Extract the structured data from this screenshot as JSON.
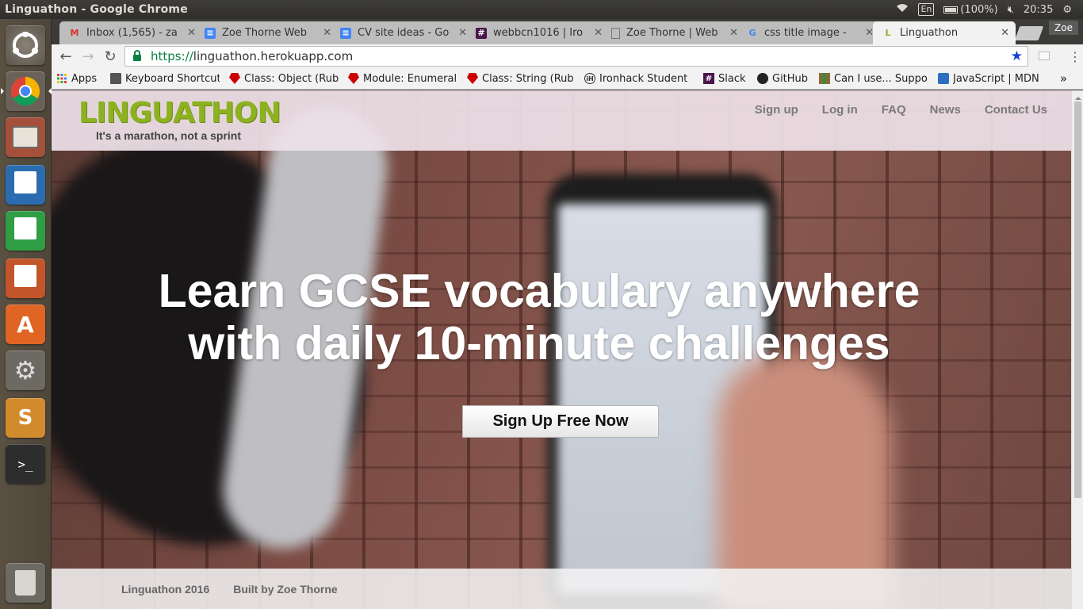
{
  "window": {
    "title": "Linguathon - Google Chrome"
  },
  "tray": {
    "keyboard": "En",
    "battery": "(100%)",
    "clock": "20:35"
  },
  "tabs": [
    {
      "label": "Inbox (1,565) - za",
      "favicon": "gmail-icon",
      "color": "#d93025"
    },
    {
      "label": "Zoe Thorne Web",
      "favicon": "docs-icon",
      "color": "#4285f4"
    },
    {
      "label": "CV site ideas - Go",
      "favicon": "docs-icon",
      "color": "#4285f4"
    },
    {
      "label": "webbcn1016 | Iro",
      "favicon": "slack-icon",
      "color": "#4a154b"
    },
    {
      "label": "Zoe Thorne | Web",
      "favicon": "page-icon",
      "color": "#777777"
    },
    {
      "label": "css title image -",
      "favicon": "google-icon",
      "color": "#4285f4"
    },
    {
      "label": "Linguathon",
      "favicon": "linguathon-icon",
      "color": "#8db21f"
    }
  ],
  "profile": "Zoe",
  "omnibox": {
    "scheme": "https://",
    "host": "linguathon.herokuapp.com"
  },
  "bookmarks": [
    {
      "label": "Apps",
      "icon": "apps-grid-icon",
      "color": "#e94235"
    },
    {
      "label": "Keyboard Shortcut",
      "icon": "keyboard-icon",
      "color": "#555555"
    },
    {
      "label": "Class: Object (Rub",
      "icon": "ruby-icon",
      "color": "#cc0000"
    },
    {
      "label": "Module: Enumeral",
      "icon": "ruby-icon",
      "color": "#cc0000"
    },
    {
      "label": "Class: String (Rub",
      "icon": "ruby-icon",
      "color": "#cc0000"
    },
    {
      "label": "Ironhack Student",
      "icon": "ironhack-icon",
      "color": "#333333"
    },
    {
      "label": "Slack",
      "icon": "slack-icon",
      "color": "#4a154b"
    },
    {
      "label": "GitHub",
      "icon": "github-icon",
      "color": "#222222"
    },
    {
      "label": "Can I use... Suppo",
      "icon": "caniuse-icon",
      "color": "#8a6a3a"
    },
    {
      "label": "JavaScript | MDN",
      "icon": "mdn-icon",
      "color": "#2c6fbf"
    }
  ],
  "bookmarks_more": "»",
  "site": {
    "logo": "LINGUATHON",
    "tagline": "It's a marathon, not a sprint",
    "nav": [
      "Sign up",
      "Log in",
      "FAQ",
      "News",
      "Contact Us"
    ],
    "headline_line1": "Learn GCSE vocabulary anywhere",
    "headline_line2": "with daily 10-minute challenges",
    "cta": "Sign Up Free Now",
    "footer": [
      "Linguathon 2016",
      "Built by Zoe Thorne"
    ]
  },
  "colors": {
    "brand": "#8db21f",
    "header_bg": "#eee1e8"
  }
}
